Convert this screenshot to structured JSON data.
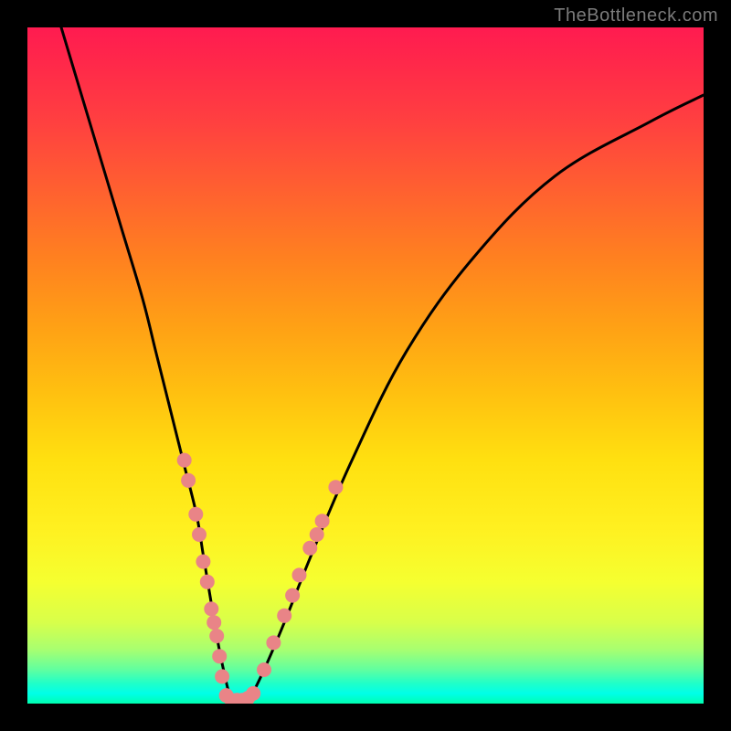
{
  "watermark": "TheBottleneck.com",
  "chart_data": {
    "type": "line",
    "title": "",
    "xlabel": "",
    "ylabel": "",
    "xlim": [
      0,
      100
    ],
    "ylim": [
      0,
      100
    ],
    "series": [
      {
        "name": "curve",
        "x": [
          5,
          8,
          11,
          14,
          17,
          19,
          21,
          23,
          25,
          26,
          27,
          28,
          29,
          30,
          31,
          32,
          33,
          35,
          38,
          42,
          48,
          56,
          66,
          78,
          92,
          100
        ],
        "y": [
          100,
          90,
          80,
          70,
          60,
          52,
          44,
          36,
          28,
          22,
          16,
          10,
          5,
          1,
          0,
          0,
          1,
          5,
          12,
          22,
          36,
          52,
          66,
          78,
          86,
          90
        ]
      }
    ],
    "markers": {
      "name": "dots",
      "color": "#e98487",
      "points": [
        {
          "x": 23.2,
          "y": 36
        },
        {
          "x": 23.8,
          "y": 33
        },
        {
          "x": 24.9,
          "y": 28
        },
        {
          "x": 25.4,
          "y": 25
        },
        {
          "x": 26.0,
          "y": 21
        },
        {
          "x": 26.6,
          "y": 18
        },
        {
          "x": 27.2,
          "y": 14
        },
        {
          "x": 27.6,
          "y": 12
        },
        {
          "x": 28.0,
          "y": 10
        },
        {
          "x": 28.4,
          "y": 7
        },
        {
          "x": 28.8,
          "y": 4
        },
        {
          "x": 29.4,
          "y": 1.2
        },
        {
          "x": 30.2,
          "y": 0.5
        },
        {
          "x": 31.0,
          "y": 0.5
        },
        {
          "x": 31.8,
          "y": 0.5
        },
        {
          "x": 32.6,
          "y": 0.8
        },
        {
          "x": 33.4,
          "y": 1.5
        },
        {
          "x": 35.0,
          "y": 5
        },
        {
          "x": 36.4,
          "y": 9
        },
        {
          "x": 38.0,
          "y": 13
        },
        {
          "x": 39.2,
          "y": 16
        },
        {
          "x": 40.2,
          "y": 19
        },
        {
          "x": 41.8,
          "y": 23
        },
        {
          "x": 42.8,
          "y": 25
        },
        {
          "x": 43.6,
          "y": 27
        },
        {
          "x": 45.6,
          "y": 32
        }
      ]
    }
  }
}
